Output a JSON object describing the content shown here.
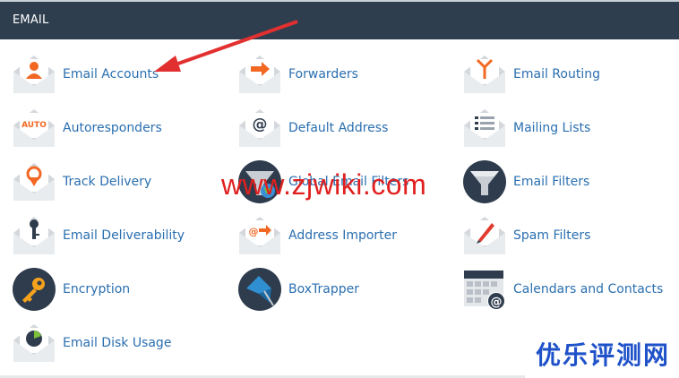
{
  "section": {
    "title": "EMAIL"
  },
  "items": [
    {
      "label": "Email Accounts",
      "icon": "user-envelope-icon"
    },
    {
      "label": "Forwarders",
      "icon": "forward-arrow-envelope-icon"
    },
    {
      "label": "Email Routing",
      "icon": "routing-envelope-icon"
    },
    {
      "label": "Autoresponders",
      "icon": "auto-envelope-icon"
    },
    {
      "label": "Default Address",
      "icon": "at-envelope-icon"
    },
    {
      "label": "Mailing Lists",
      "icon": "list-envelope-icon"
    },
    {
      "label": "Track Delivery",
      "icon": "location-pin-envelope-icon"
    },
    {
      "label": "Global Email Filters",
      "icon": "globe-funnel-icon"
    },
    {
      "label": "Email Filters",
      "icon": "funnel-icon"
    },
    {
      "label": "Email Deliverability",
      "icon": "key-envelope-icon"
    },
    {
      "label": "Address Importer",
      "icon": "import-envelope-icon"
    },
    {
      "label": "Spam Filters",
      "icon": "pen-envelope-icon"
    },
    {
      "label": "Encryption",
      "icon": "key-badge-icon"
    },
    {
      "label": "BoxTrapper",
      "icon": "trap-box-icon"
    },
    {
      "label": "Calendars and Contacts",
      "icon": "calendar-at-icon"
    },
    {
      "label": "Email Disk Usage",
      "icon": "pie-chart-envelope-icon"
    }
  ],
  "watermark": {
    "url": "www.zjwiki.com",
    "cn": "优乐评测网"
  },
  "colors": {
    "header_bg": "#2f3e4f",
    "link": "#2a6fb0",
    "accent_orange": "#f26722",
    "dark_circle": "#2e3c4d",
    "watermark_red": "#e0201f",
    "watermark_blue": "#1f52c9"
  }
}
